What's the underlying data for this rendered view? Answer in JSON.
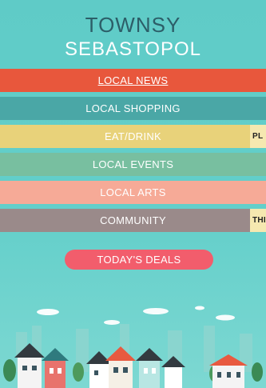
{
  "brand": {
    "line1": "TOWNSY",
    "line2": "SEBASTOPOL"
  },
  "menu": [
    {
      "label": "LOCAL NEWS",
      "color": "#e8573c",
      "active": true
    },
    {
      "label": "LOCAL SHOPPING",
      "color": "#4aa7a6"
    },
    {
      "label": "EAT/DRINK",
      "color": "#e8d27a",
      "edge_tag": "PL",
      "edge_tag_bg": "#f5e8b0"
    },
    {
      "label": "LOCAL EVENTS",
      "color": "#78bfa0"
    },
    {
      "label": "LOCAL ARTS",
      "color": "#f6aa97"
    },
    {
      "label": "COMMUNITY",
      "color": "#9a8a8a",
      "edge_tag": "THI",
      "edge_tag_bg": "#f5e8b0"
    }
  ],
  "deals": {
    "label": "TODAY'S DEALS",
    "color": "#f25d6c"
  },
  "scene_icons": [
    "cloud-icon",
    "skyline-icon",
    "house-icon",
    "tree-icon"
  ]
}
